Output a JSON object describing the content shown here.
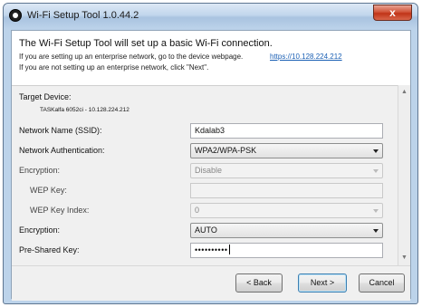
{
  "window": {
    "title": "Wi-Fi Setup Tool 1.0.44.2",
    "close_glyph": "x"
  },
  "header": {
    "heading": "The Wi-Fi Setup Tool will set up a basic Wi-Fi connection.",
    "line1": "If you are setting up an enterprise network, go to the device webpage.",
    "link": "https://10.128.224.212",
    "line2": "If you are not setting up an enterprise network, click \"Next\"."
  },
  "form": {
    "target_device_label": "Target Device:",
    "target_device_value": "TASKalfa 6052ci - 10.128.224.212",
    "ssid_label": "Network Name (SSID):",
    "ssid_value": "Kdalab3",
    "auth_label": "Network Authentication:",
    "auth_value": "WPA2/WPA-PSK",
    "encryption1_label": "Encryption:",
    "encryption1_value": "Disable",
    "wep_key_label": "WEP Key:",
    "wep_key_value": "",
    "wep_index_label": "WEP Key Index:",
    "wep_index_value": "0",
    "encryption2_label": "Encryption:",
    "encryption2_value": "AUTO",
    "psk_label": "Pre-Shared Key:",
    "psk_value": "••••••••••"
  },
  "scroll": {
    "up": "▲",
    "down": "▼"
  },
  "buttons": {
    "back": "< Back",
    "next": "Next >",
    "cancel": "Cancel"
  },
  "icons": {
    "app": "wifi-tool-icon",
    "close": "close-icon",
    "dropdown": "chevron-down-icon"
  },
  "colors": {
    "link": "#1a5fb4",
    "close_button": "#c03418",
    "frame": "#bcd3ea"
  }
}
